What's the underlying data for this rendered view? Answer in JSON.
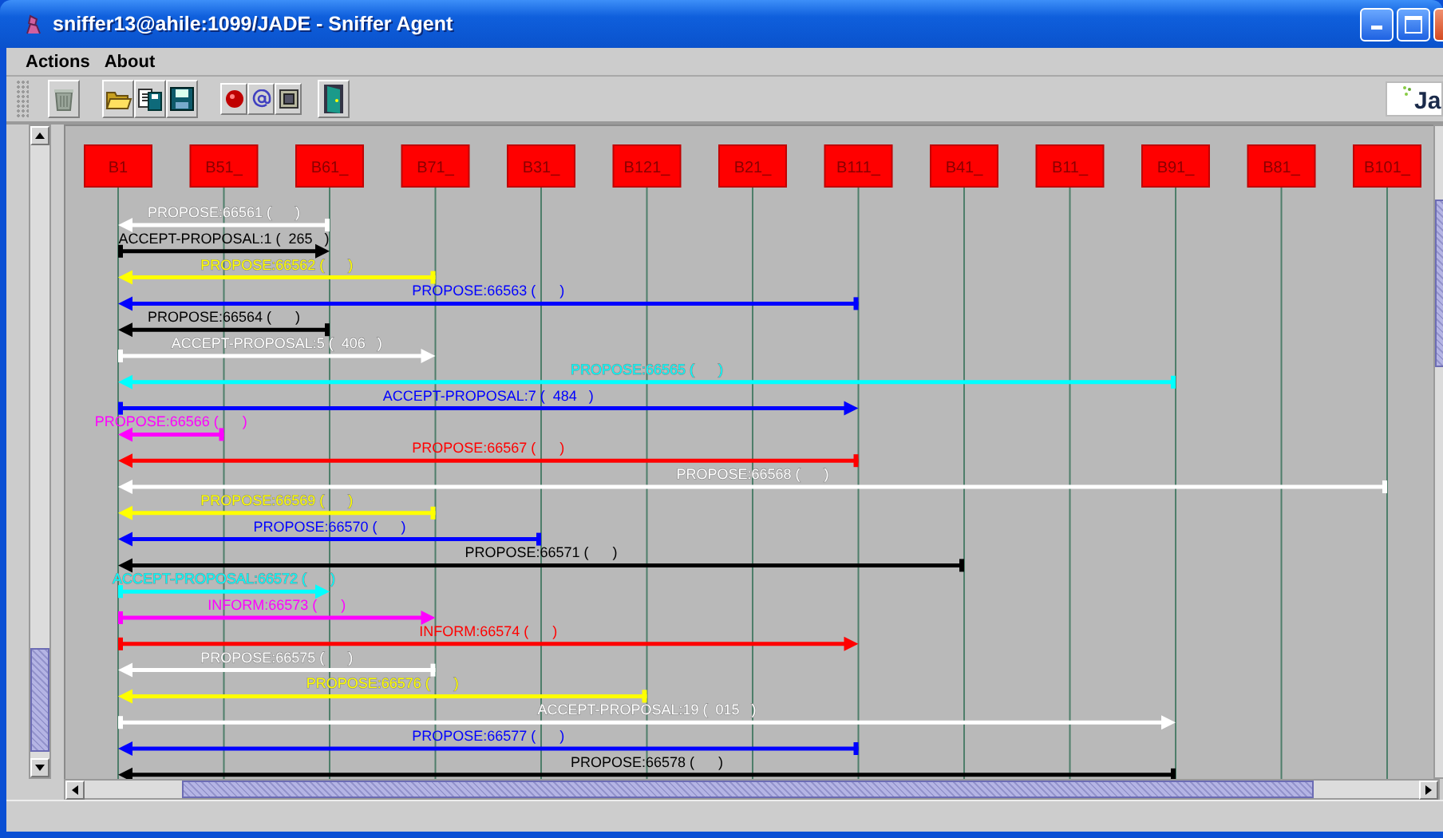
{
  "window": {
    "title": "sniffer13@ahile:1099/JADE - Sniffer Agent"
  },
  "menu": [
    "Actions",
    "About"
  ],
  "toolbar": {
    "logo_text": "Ja"
  },
  "agents": [
    {
      "name": "B1"
    },
    {
      "name": "B51_"
    },
    {
      "name": "B61_"
    },
    {
      "name": "B71_"
    },
    {
      "name": "B31_"
    },
    {
      "name": "B121_"
    },
    {
      "name": "B21_"
    },
    {
      "name": "B111_"
    },
    {
      "name": "B41_"
    },
    {
      "name": "B11_"
    },
    {
      "name": "B91_"
    },
    {
      "name": "B81_"
    },
    {
      "name": "B101_"
    }
  ],
  "messages": [
    {
      "label": "PROPOSE:66561 (      )",
      "kind": "incoming",
      "level": 0.1667,
      "color": "#ffffff"
    },
    {
      "label": "ACCEPT-PROPOSAL:1 (  265   )",
      "kind": "outgoing",
      "level": 0.1667,
      "color": "#000000"
    },
    {
      "label": "PROPOSE:66562 (      )",
      "kind": "incoming",
      "level": 0.25,
      "color": "#ffff00"
    },
    {
      "label": "PROPOSE:66563 (      )",
      "kind": "incoming",
      "level": 0.5833,
      "color": "#0000ff"
    },
    {
      "label": "PROPOSE:66564 (      )",
      "kind": "incoming",
      "level": 0.1667,
      "color": "#000000"
    },
    {
      "label": "ACCEPT-PROPOSAL:5 (  406   )",
      "kind": "outgoing",
      "level": 0.25,
      "color": "#ffffff"
    },
    {
      "label": "PROPOSE:66565 (      )",
      "kind": "incoming",
      "level": 0.8333,
      "color": "#00ffff"
    },
    {
      "label": "ACCEPT-PROPOSAL:7 (  484   )",
      "kind": "outgoing",
      "level": 0.5833,
      "color": "#0000ff"
    },
    {
      "label": "PROPOSE:66566 (      )",
      "kind": "incoming",
      "level": 0.0833,
      "color": "#ff00ff"
    },
    {
      "label": "PROPOSE:66567 (      )",
      "kind": "incoming",
      "level": 0.5833,
      "color": "#ff0000"
    },
    {
      "label": "PROPOSE:66568 (      )",
      "kind": "incoming",
      "level": 1,
      "color": "#ffffff"
    },
    {
      "label": "PROPOSE:66569 (      )",
      "kind": "incoming",
      "level": 0.25,
      "color": "#ffff00"
    },
    {
      "label": "PROPOSE:66570 (      )",
      "kind": "incoming",
      "level": 0.3333,
      "color": "#0000ff"
    },
    {
      "label": "PROPOSE:66571 (      )",
      "kind": "incoming",
      "level": 0.6667,
      "color": "#000000"
    },
    {
      "label": "ACCEPT-PROPOSAL:66572 (      )",
      "kind": "outgoing",
      "level": 0.1667,
      "color": "#00ffff"
    },
    {
      "label": "INFORM:66573 (      )",
      "kind": "outgoing",
      "level": 0.25,
      "color": "#ff00ff"
    },
    {
      "label": "INFORM:66574 (      )",
      "kind": "outgoing",
      "level": 0.5833,
      "color": "#ff0000"
    },
    {
      "label": "PROPOSE:66575 (      )",
      "kind": "incoming",
      "level": 0.25,
      "color": "#ffffff"
    },
    {
      "label": "PROPOSE:66576 (      )",
      "kind": "incoming",
      "level": 0.4167,
      "color": "#ffff00"
    },
    {
      "label": "ACCEPT-PROPOSAL:19 (  015   )",
      "kind": "outgoing",
      "level": 0.8333,
      "color": "#ffffff"
    },
    {
      "label": "PROPOSE:66577 (      )",
      "kind": "incoming",
      "level": 0.5833,
      "color": "#0000ff"
    },
    {
      "label": "PROPOSE:66578 (      )",
      "kind": "incoming",
      "level": 0.8333,
      "color": "#000000"
    }
  ]
}
